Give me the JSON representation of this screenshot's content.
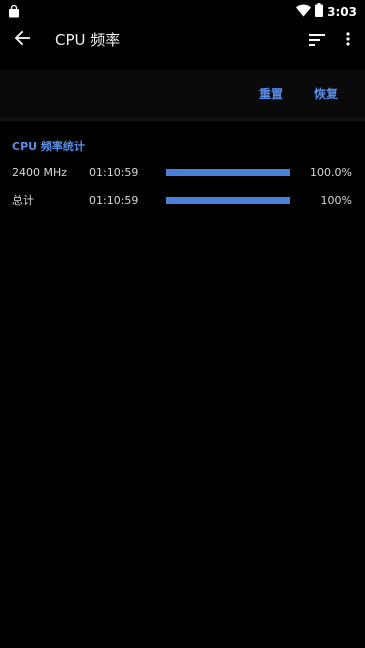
{
  "status_bar": {
    "time": "3:03",
    "icons": [
      "shopping-bag-icon",
      "wifi-icon",
      "battery-icon"
    ]
  },
  "app_bar": {
    "title": "CPU 频率",
    "icons": [
      "back-arrow-icon",
      "sort-icon",
      "more-vert-icon"
    ]
  },
  "toolbar": {
    "reset_label": "重置",
    "restore_label": "恢复"
  },
  "section": {
    "title": "CPU 频率统计",
    "rows": [
      {
        "label": "2400 MHz",
        "time": "01:10:59",
        "fraction": 1.0,
        "percent": "100.0%"
      },
      {
        "label": "总计",
        "time": "01:10:59",
        "fraction": 1.0,
        "percent": "100%"
      }
    ]
  },
  "colors": {
    "background": "#000000",
    "accent": "#5b8ee6",
    "bar": "#4a7fdb",
    "text": "#d8d8d8"
  }
}
